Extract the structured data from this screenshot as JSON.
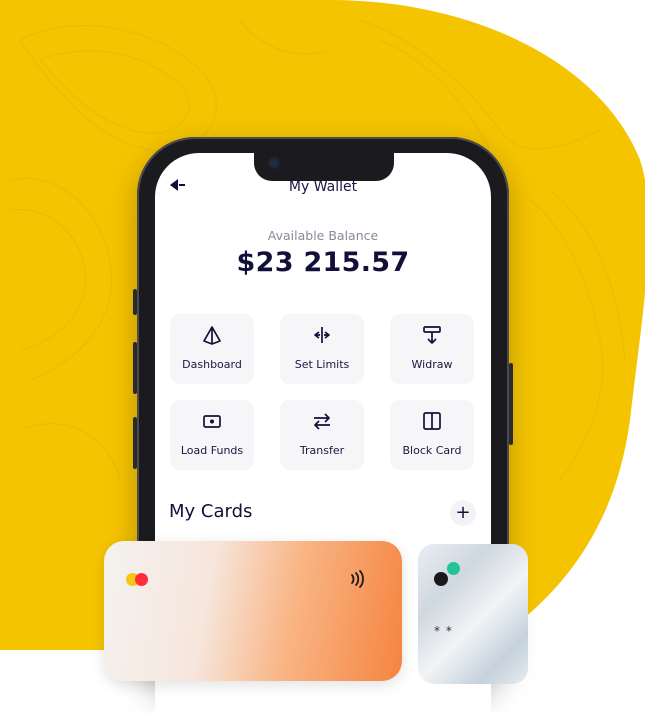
{
  "screen": {
    "title": "My Wallet",
    "balance_label": "Available Balance",
    "balance_value": "$23 215.57"
  },
  "actions": [
    {
      "label": "Dashboard",
      "icon": "pyramid-icon"
    },
    {
      "label": "Set Limits",
      "icon": "resize-arrows-icon"
    },
    {
      "label": "Widraw",
      "icon": "withdraw-icon"
    },
    {
      "label": "Load Funds",
      "icon": "cash-icon"
    },
    {
      "label": "Transfer",
      "icon": "transfer-arrows-icon"
    },
    {
      "label": "Block Card",
      "icon": "book-icon"
    }
  ],
  "cards": {
    "title": "My Cards",
    "add_label": "+",
    "second_card_masked": "* *"
  },
  "colors": {
    "background_blob": "#F5C400",
    "text_primary": "#12103A",
    "card_orange": "#F5843F",
    "accent_green": "#22C39A"
  }
}
